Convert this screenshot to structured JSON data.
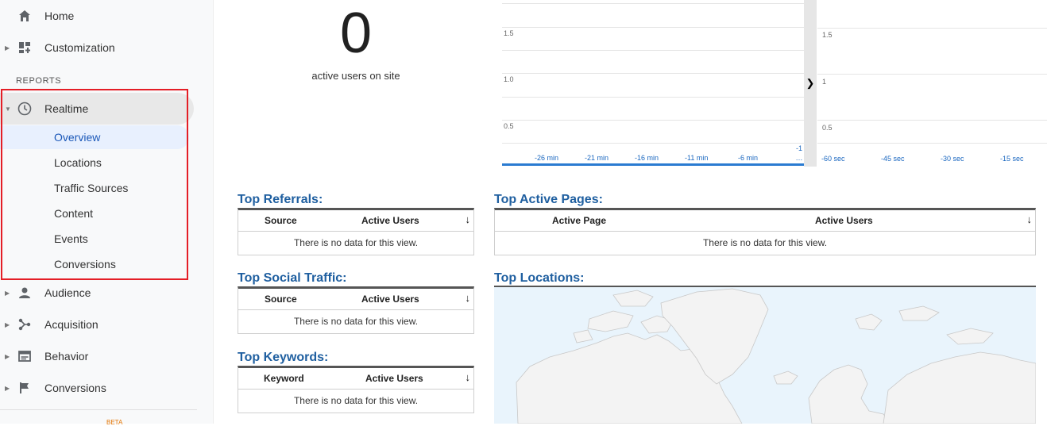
{
  "sidebar": {
    "items_top": [
      {
        "label": "Home",
        "icon": "home-icon"
      },
      {
        "label": "Customization",
        "icon": "dashboard-icon"
      }
    ],
    "section_label": "REPORTS",
    "realtime": {
      "label": "Realtime",
      "icon": "clock-icon",
      "sub": [
        "Overview",
        "Locations",
        "Traffic Sources",
        "Content",
        "Events",
        "Conversions"
      ],
      "active": "Overview"
    },
    "items_bottom": [
      {
        "label": "Audience",
        "icon": "person-icon"
      },
      {
        "label": "Acquisition",
        "icon": "acquisition-icon"
      },
      {
        "label": "Behavior",
        "icon": "behavior-icon"
      },
      {
        "label": "Conversions",
        "icon": "flag-icon"
      }
    ],
    "beta": "BETA"
  },
  "summary": {
    "active_users": "0",
    "caption": "active users on site"
  },
  "per_minute_chart": {
    "y_ticks": [
      "1.5",
      "1.0",
      "0.5"
    ],
    "x_ticks": [
      "-26 min",
      "-21 min",
      "-16 min",
      "-11 min",
      "-6 min",
      "-1 …"
    ]
  },
  "per_second_chart": {
    "y_ticks": [
      "1.5",
      "1",
      "0.5"
    ],
    "x_ticks": [
      "-60 sec",
      "-45 sec",
      "-30 sec",
      "-15 sec"
    ]
  },
  "top_referrals": {
    "title": "Top Referrals:",
    "col1": "Source",
    "col2": "Active Users",
    "empty": "There is no data for this view."
  },
  "top_social": {
    "title": "Top Social Traffic:",
    "col1": "Source",
    "col2": "Active Users",
    "empty": "There is no data for this view."
  },
  "top_keywords": {
    "title": "Top Keywords:",
    "col1": "Keyword",
    "col2": "Active Users",
    "empty": "There is no data for this view."
  },
  "top_pages": {
    "title": "Top Active Pages:",
    "col1": "Active Page",
    "col2": "Active Users",
    "empty": "There is no data for this view."
  },
  "top_locations": {
    "title": "Top Locations:"
  },
  "colors": {
    "accent": "#1f5fa0",
    "highlight_box": "#e41e26",
    "active_bg": "#e8f0fe"
  }
}
